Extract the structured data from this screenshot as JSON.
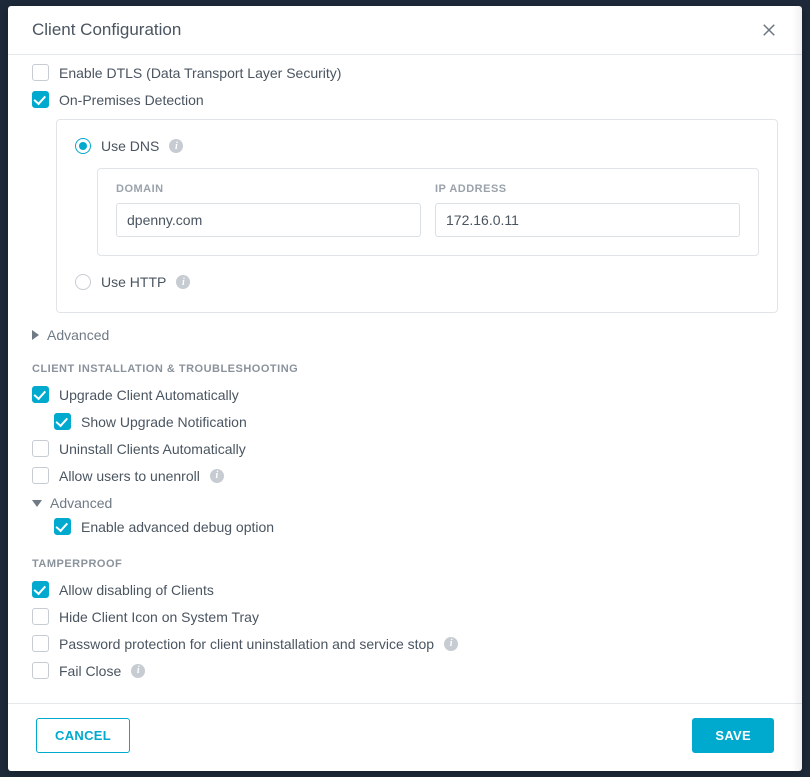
{
  "dialog": {
    "title": "Client Configuration",
    "close_icon": "close"
  },
  "top": {
    "enable_dtls": {
      "label": "Enable DTLS (Data Transport Layer Security)",
      "checked": false
    },
    "on_prem": {
      "label": "On-Premises Detection",
      "checked": true
    }
  },
  "onprem_panel": {
    "use_dns": {
      "label": "Use DNS",
      "selected": true
    },
    "use_http": {
      "label": "Use HTTP",
      "selected": false
    },
    "domain_label": "DOMAIN",
    "ip_label": "IP ADDRESS",
    "domain_value": "dpenny.com",
    "ip_value": "172.16.0.11"
  },
  "advanced1": {
    "label": "Advanced",
    "expanded": false
  },
  "section_install": "CLIENT INSTALLATION & TROUBLESHOOTING",
  "install": {
    "upgrade_auto": {
      "label": "Upgrade Client Automatically",
      "checked": true
    },
    "show_upgrade": {
      "label": "Show Upgrade Notification",
      "checked": true
    },
    "uninstall_auto": {
      "label": "Uninstall Clients Automatically",
      "checked": false
    },
    "allow_unenroll": {
      "label": "Allow users to unenroll",
      "checked": false
    }
  },
  "advanced2": {
    "label": "Advanced",
    "expanded": true,
    "enable_debug": {
      "label": "Enable advanced debug option",
      "checked": true
    }
  },
  "section_tamper": "TAMPERPROOF",
  "tamper": {
    "allow_disable": {
      "label": "Allow disabling of Clients",
      "checked": true
    },
    "hide_tray": {
      "label": "Hide Client Icon on System Tray",
      "checked": false
    },
    "pw_protect": {
      "label": "Password protection for client uninstallation and service stop",
      "checked": false
    },
    "fail_close": {
      "label": "Fail Close",
      "checked": false
    }
  },
  "footer": {
    "cancel": "CANCEL",
    "save": "SAVE"
  }
}
